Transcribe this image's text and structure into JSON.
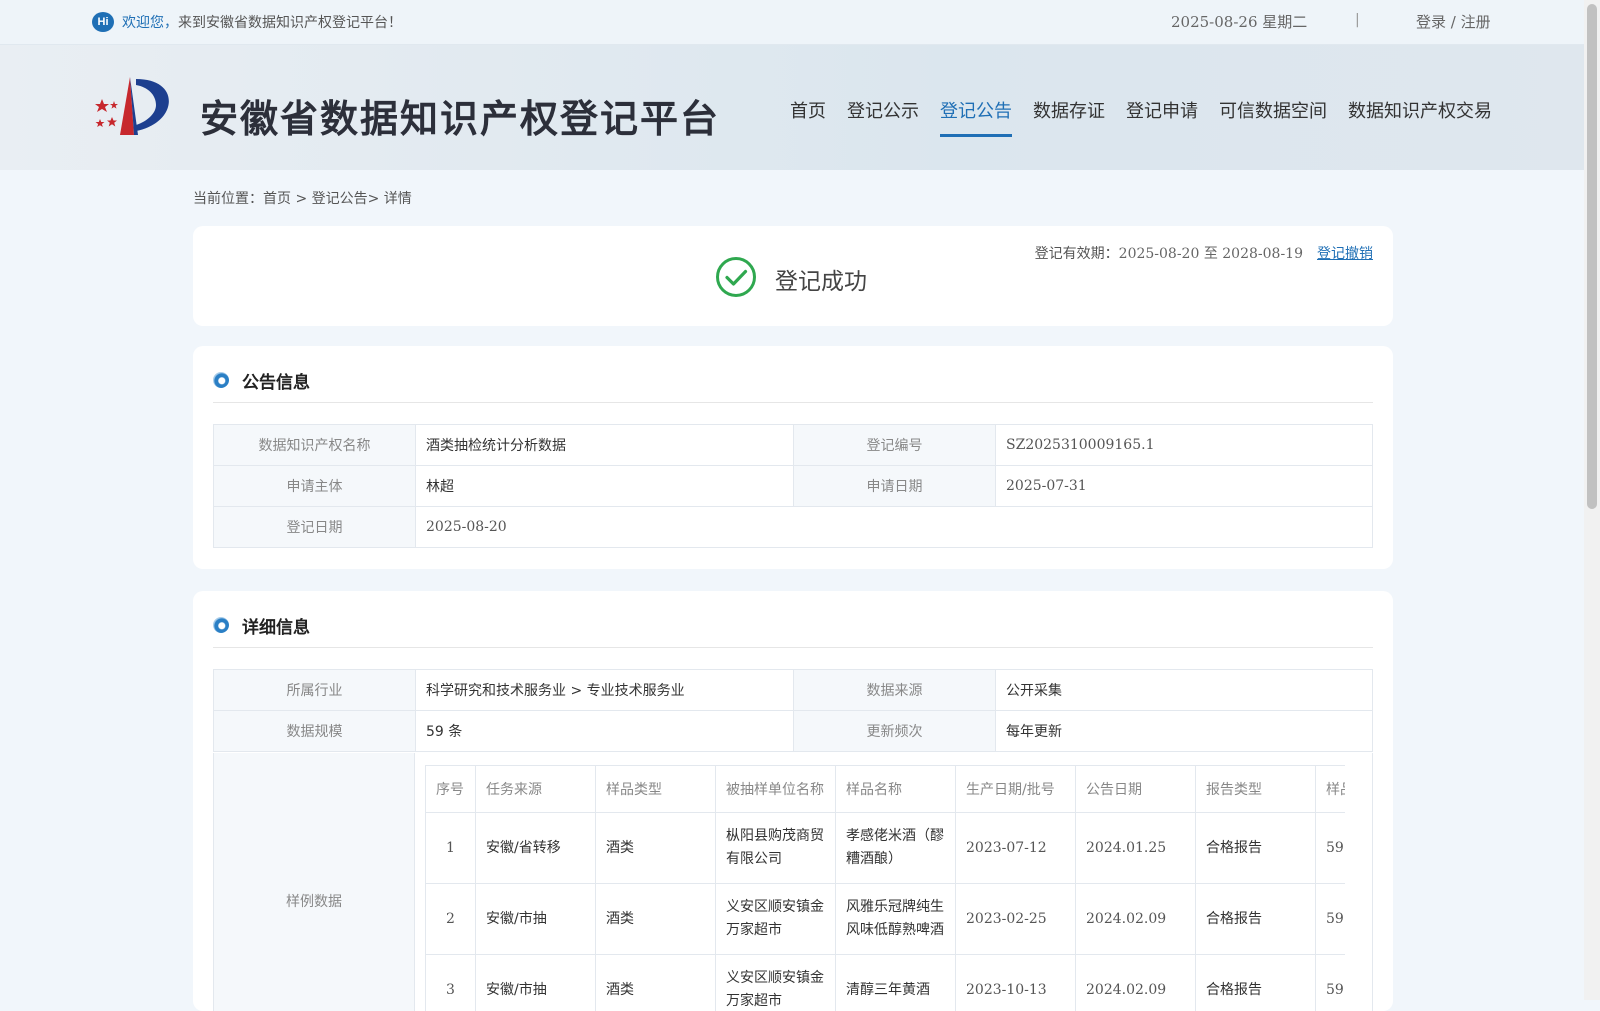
{
  "topbar": {
    "hi": "Hi",
    "welcome": "欢迎您，",
    "welcome_rest": "来到安徽省数据知识产权登记平台！",
    "date": "2025-08-26 星期二",
    "separator": "|",
    "login": "登录 / 注册"
  },
  "header": {
    "site_title": "安徽省数据知识产权登记平台",
    "nav": [
      "首页",
      "登记公示",
      "登记公告",
      "数据存证",
      "登记申请",
      "可信数据空间",
      "数据知识产权交易"
    ],
    "active_nav": "登记公告"
  },
  "breadcrumb": "当前位置：首页 > 登记公告> 详情",
  "status": {
    "validity_label": "登记有效期：",
    "validity_value": "2025-08-20 至 2028-08-19",
    "revoke": "登记撤销",
    "text": "登记成功",
    "color": "#2fa84f"
  },
  "announcement": {
    "title": "公告信息",
    "name_label": "数据知识产权名称",
    "name_value": "酒类抽检统计分析数据",
    "reg_no_label": "登记编号",
    "reg_no_value": "SZ2025310009165.1",
    "applicant_label": "申请主体",
    "applicant_value": "林超",
    "apply_date_label": "申请日期",
    "apply_date_value": "2025-07-31",
    "reg_date_label": "登记日期",
    "reg_date_value": "2025-08-20"
  },
  "detail": {
    "title": "详细信息",
    "industry_label": "所属行业",
    "industry_value": "科学研究和技术服务业 > 专业技术服务业",
    "source_label": "数据来源",
    "source_value": "公开采集",
    "scale_label": "数据规模",
    "scale_value": "59 条",
    "freq_label": "更新频次",
    "freq_value": "每年更新",
    "sample_label": "样例数据",
    "columns": [
      "序号",
      "任务来源",
      "样品类型",
      "被抽样单位名称",
      "样品名称",
      "生产日期/批号",
      "公告日期",
      "报告类型",
      "样品"
    ],
    "rows": [
      [
        "1",
        "安徽/省转移",
        "酒类",
        "枞阳县购茂商贸有限公司",
        "孝感佬米酒（醪糟酒酿）",
        "2023-07-12",
        "2024.01.25",
        "合格报告",
        "59"
      ],
      [
        "2",
        "安徽/市抽",
        "酒类",
        "义安区顺安镇金万家超市",
        "风雅乐冠牌纯生风味低醇熟啤酒",
        "2023-02-25",
        "2024.02.09",
        "合格报告",
        "59"
      ],
      [
        "3",
        "安徽/市抽",
        "酒类",
        "义安区顺安镇金万家超市",
        "清醇三年黄酒",
        "2023-10-13",
        "2024.02.09",
        "合格报告",
        "59"
      ]
    ]
  },
  "colors": {
    "accent": "#1f6fb5",
    "background": "#f1f6fb"
  }
}
